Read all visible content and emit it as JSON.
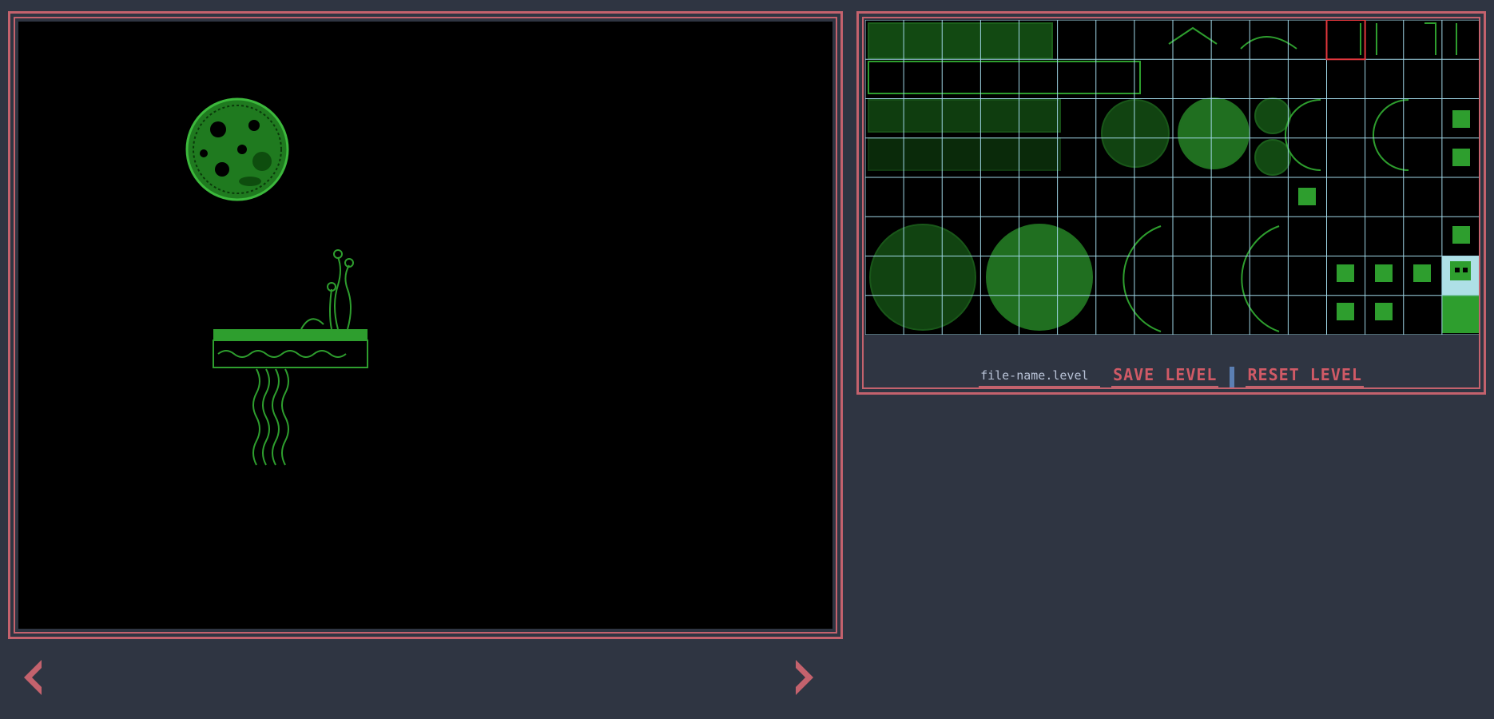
{
  "editor": {
    "tile_color": "#2e9e2e",
    "background": "#000000"
  },
  "palette": {
    "grid_color": "#9fd6e6",
    "selection_color": "#e0363c",
    "columns": 16,
    "rows": 8
  },
  "toolbar": {
    "filename": "file-name.level",
    "save_label": "SAVE LEVEL",
    "reset_label": "RESET LEVEL"
  },
  "navigation": {
    "prev_icon": "chevron-left-icon",
    "next_icon": "chevron-right-icon"
  },
  "colors": {
    "frame": "#c4626d",
    "page_bg": "#2f3542",
    "separator": "#5b7fb3"
  }
}
